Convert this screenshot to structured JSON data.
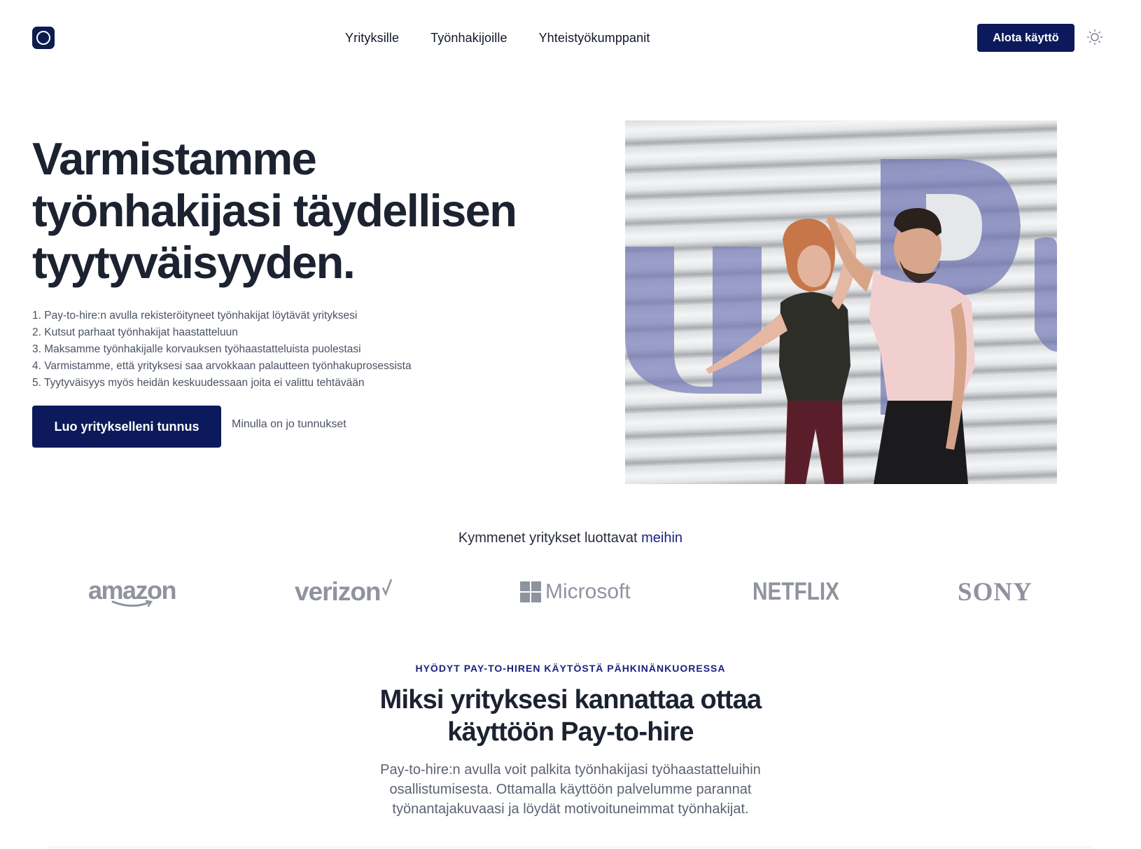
{
  "header": {
    "nav": [
      {
        "label": "Yrityksille"
      },
      {
        "label": "Työnhakijoille"
      },
      {
        "label": "Yhteistyökumppanit"
      }
    ],
    "cta_label": "Alota käyttö",
    "theme_icon": "sun-icon",
    "logo_icon": "ring-logo-icon"
  },
  "hero": {
    "title": "Varmistamme työnhakijasi täydellisen tyytyväisyyden.",
    "list": [
      "1. Pay-to-hire:n avulla rekisteröityneet työnhakijat löytävät yrityksesi",
      "2. Kutsut parhaat työnhakijat haastatteluun",
      "3. Maksamme työnhakijalle korvauksen työhaastatteluista puolestasi",
      "4. Varmistamme, että yrityksesi saa arvokkaan palautteen työnhakuprosessista",
      "5. Tyytyväisyys myös heidän keskuudessaan joita ei valittu tehtävään"
    ],
    "primary_button": "Luo yritykselleni tunnus",
    "secondary_link": "Minulla on jo tunnukset",
    "image_alt": "Kaksi iloista ihmistä aaltopeltiseinän edessä"
  },
  "trust": {
    "text": "Kymmenet yritykset luottavat",
    "accent": "meihin",
    "logos": [
      "amazon",
      "verizon",
      "Microsoft",
      "NETFLIX",
      "SONY"
    ]
  },
  "why": {
    "eyebrow": "HYÖDYT PAY-TO-HIREN KÄYTÖSTÄ PÄHKINÄNKUORESSA",
    "title": "Miksi yrityksesi kannattaa ottaa käyttöön Pay-to-hire",
    "description": "Pay-to-hire:n avulla voit palkita työnhakijasi työhaastatteluihin osallistumisesta. Ottamalla käyttöön palvelumme parannat työnantajakuvaasi ja löydät motivoituneimmat työnhakijat."
  },
  "colors": {
    "brand_navy": "#0c1a5b",
    "accent_blue": "#1a237e",
    "heading": "#1c2230",
    "muted_text": "#4b5262",
    "logo_gray": "#8f939e"
  }
}
